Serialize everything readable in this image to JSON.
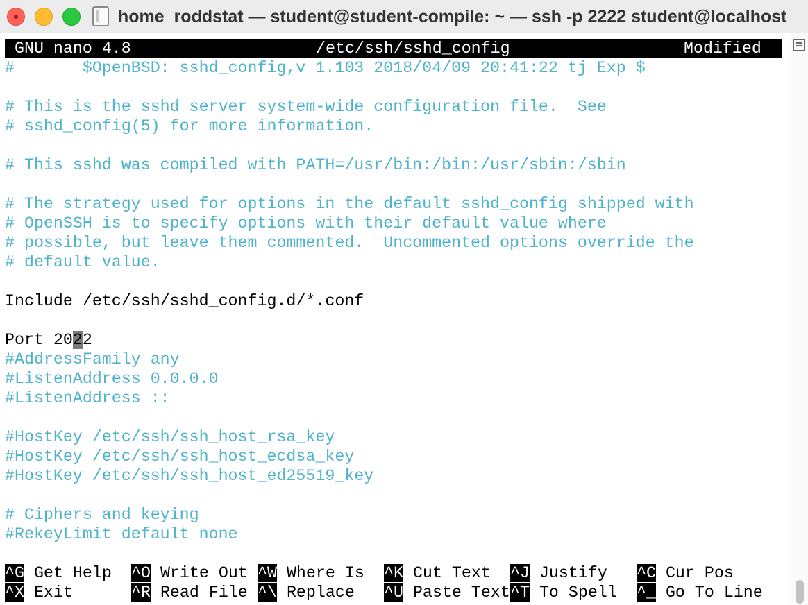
{
  "window": {
    "title": "home_roddstat — student@student-compile: ~ — ssh -p 2222 student@localhost"
  },
  "editor": {
    "app_name": "GNU nano 4.8",
    "filename": "/etc/ssh/sshd_config",
    "status": "Modified"
  },
  "lines": [
    {
      "text": "#       $OpenBSD: sshd_config,v 1.103 2018/04/09 20:41:22 tj Exp $",
      "type": "comment"
    },
    {
      "text": "",
      "type": "blank"
    },
    {
      "text": "# This is the sshd server system-wide configuration file.  See",
      "type": "comment"
    },
    {
      "text": "# sshd_config(5) for more information.",
      "type": "comment"
    },
    {
      "text": "",
      "type": "blank"
    },
    {
      "text": "# This sshd was compiled with PATH=/usr/bin:/bin:/usr/sbin:/sbin",
      "type": "comment"
    },
    {
      "text": "",
      "type": "blank"
    },
    {
      "text": "# The strategy used for options in the default sshd_config shipped with",
      "type": "comment"
    },
    {
      "text": "# OpenSSH is to specify options with their default value where",
      "type": "comment"
    },
    {
      "text": "# possible, but leave them commented.  Uncommented options override the",
      "type": "comment"
    },
    {
      "text": "# default value.",
      "type": "comment"
    },
    {
      "text": "",
      "type": "blank"
    },
    {
      "text": "Include /etc/ssh/sshd_config.d/*.conf",
      "type": "code"
    },
    {
      "text": "",
      "type": "blank"
    },
    {
      "text": "Port 2022",
      "type": "code",
      "cursor_col": 7
    },
    {
      "text": "#AddressFamily any",
      "type": "comment"
    },
    {
      "text": "#ListenAddress 0.0.0.0",
      "type": "comment"
    },
    {
      "text": "#ListenAddress ::",
      "type": "comment"
    },
    {
      "text": "",
      "type": "blank"
    },
    {
      "text": "#HostKey /etc/ssh/ssh_host_rsa_key",
      "type": "comment"
    },
    {
      "text": "#HostKey /etc/ssh/ssh_host_ecdsa_key",
      "type": "comment"
    },
    {
      "text": "#HostKey /etc/ssh/ssh_host_ed25519_key",
      "type": "comment"
    },
    {
      "text": "",
      "type": "blank"
    },
    {
      "text": "# Ciphers and keying",
      "type": "comment"
    },
    {
      "text": "#RekeyLimit default none",
      "type": "comment"
    }
  ],
  "shortcuts": [
    [
      {
        "key": "^G",
        "label": "Get Help"
      },
      {
        "key": "^O",
        "label": "Write Out"
      },
      {
        "key": "^W",
        "label": "Where Is"
      },
      {
        "key": "^K",
        "label": "Cut Text"
      },
      {
        "key": "^J",
        "label": "Justify"
      },
      {
        "key": "^C",
        "label": "Cur Pos"
      }
    ],
    [
      {
        "key": "^X",
        "label": "Exit"
      },
      {
        "key": "^R",
        "label": "Read File"
      },
      {
        "key": "^\\",
        "label": "Replace"
      },
      {
        "key": "^U",
        "label": "Paste Text"
      },
      {
        "key": "^T",
        "label": "To Spell"
      },
      {
        "key": "^_",
        "label": "Go To Line"
      }
    ]
  ],
  "colors": {
    "comment": "#4fb3c9",
    "code": "#000000",
    "bar_bg": "#000000",
    "bar_fg": "#ffffff"
  },
  "icons": {
    "close": "close-icon",
    "minimize": "minimize-icon",
    "maximize": "maximize-icon",
    "document": "document-icon",
    "split_view": "split-view-icon"
  }
}
